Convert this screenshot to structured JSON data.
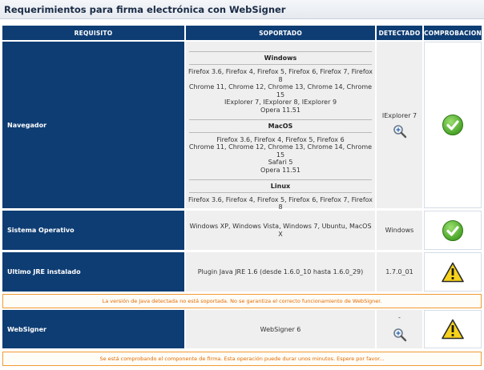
{
  "page": {
    "title": "Requerimientos para firma electrónica con WebSigner"
  },
  "table": {
    "headers": {
      "requisito": "REQUISITO",
      "soportado": "SOPORTADO",
      "detectado": "DETECTADO",
      "comprobacion": "COMPROBACION"
    },
    "rows": {
      "navegador": {
        "label": "Navegador",
        "detected": "IExplorer 7",
        "status": "ok",
        "os": [
          {
            "name": "Windows",
            "lines": [
              "Firefox 3.6, Firefox 4, Firefox 5, Firefox 6, Firefox 7, Firefox 8",
              "Chrome 11, Chrome 12, Chrome 13, Chrome 14, Chrome 15",
              "IExplorer 7, IExplorer 8, IExplorer 9",
              "Opera 11.51"
            ]
          },
          {
            "name": "MacOS",
            "lines": [
              "Firefox 3.6, Firefox 4, Firefox 5, Firefox 6",
              "Chrome 11, Chrome 12, Chrome 13, Chrome 14, Chrome 15",
              "Safari 5",
              "Opera 11.51"
            ]
          },
          {
            "name": "Linux",
            "lines": [
              "Firefox 3.6, Firefox 4, Firefox 5, Firefox 6, Firefox 7, Firefox 8"
            ]
          }
        ]
      },
      "sistema": {
        "label": "Sistema Operativo",
        "supported": "Windows XP, Windows Vista, Windows 7, Ubuntu, MacOS X",
        "detected": "Windows",
        "status": "ok"
      },
      "jre": {
        "label": "Ultimo JRE instalado",
        "supported": "Plugin Java JRE 1.6 (desde 1.6.0_10 hasta 1.6.0_29)",
        "detected": "1.7.0_01",
        "status": "warning",
        "message": "La versión de Java detectada no está soportada. No se garantiza el correcto funcionamiento de WebSigner."
      },
      "websigner": {
        "label": "WebSigner",
        "supported": "WebSigner 6",
        "detected": "-",
        "status": "warning",
        "message": "Se está comprobando el componente de firma. Esta operación puede durar unos minutos. Espere por favor..."
      }
    }
  },
  "icons": {
    "ok": "check-circle-icon",
    "warning": "warning-triangle-icon",
    "zoom": "magnifier-plus-icon"
  },
  "colors": {
    "header_bg": "#0e3d73",
    "ok_green": "#4caf2a",
    "warning_yellow": "#f7d31c",
    "message_orange": "#e36b00"
  }
}
